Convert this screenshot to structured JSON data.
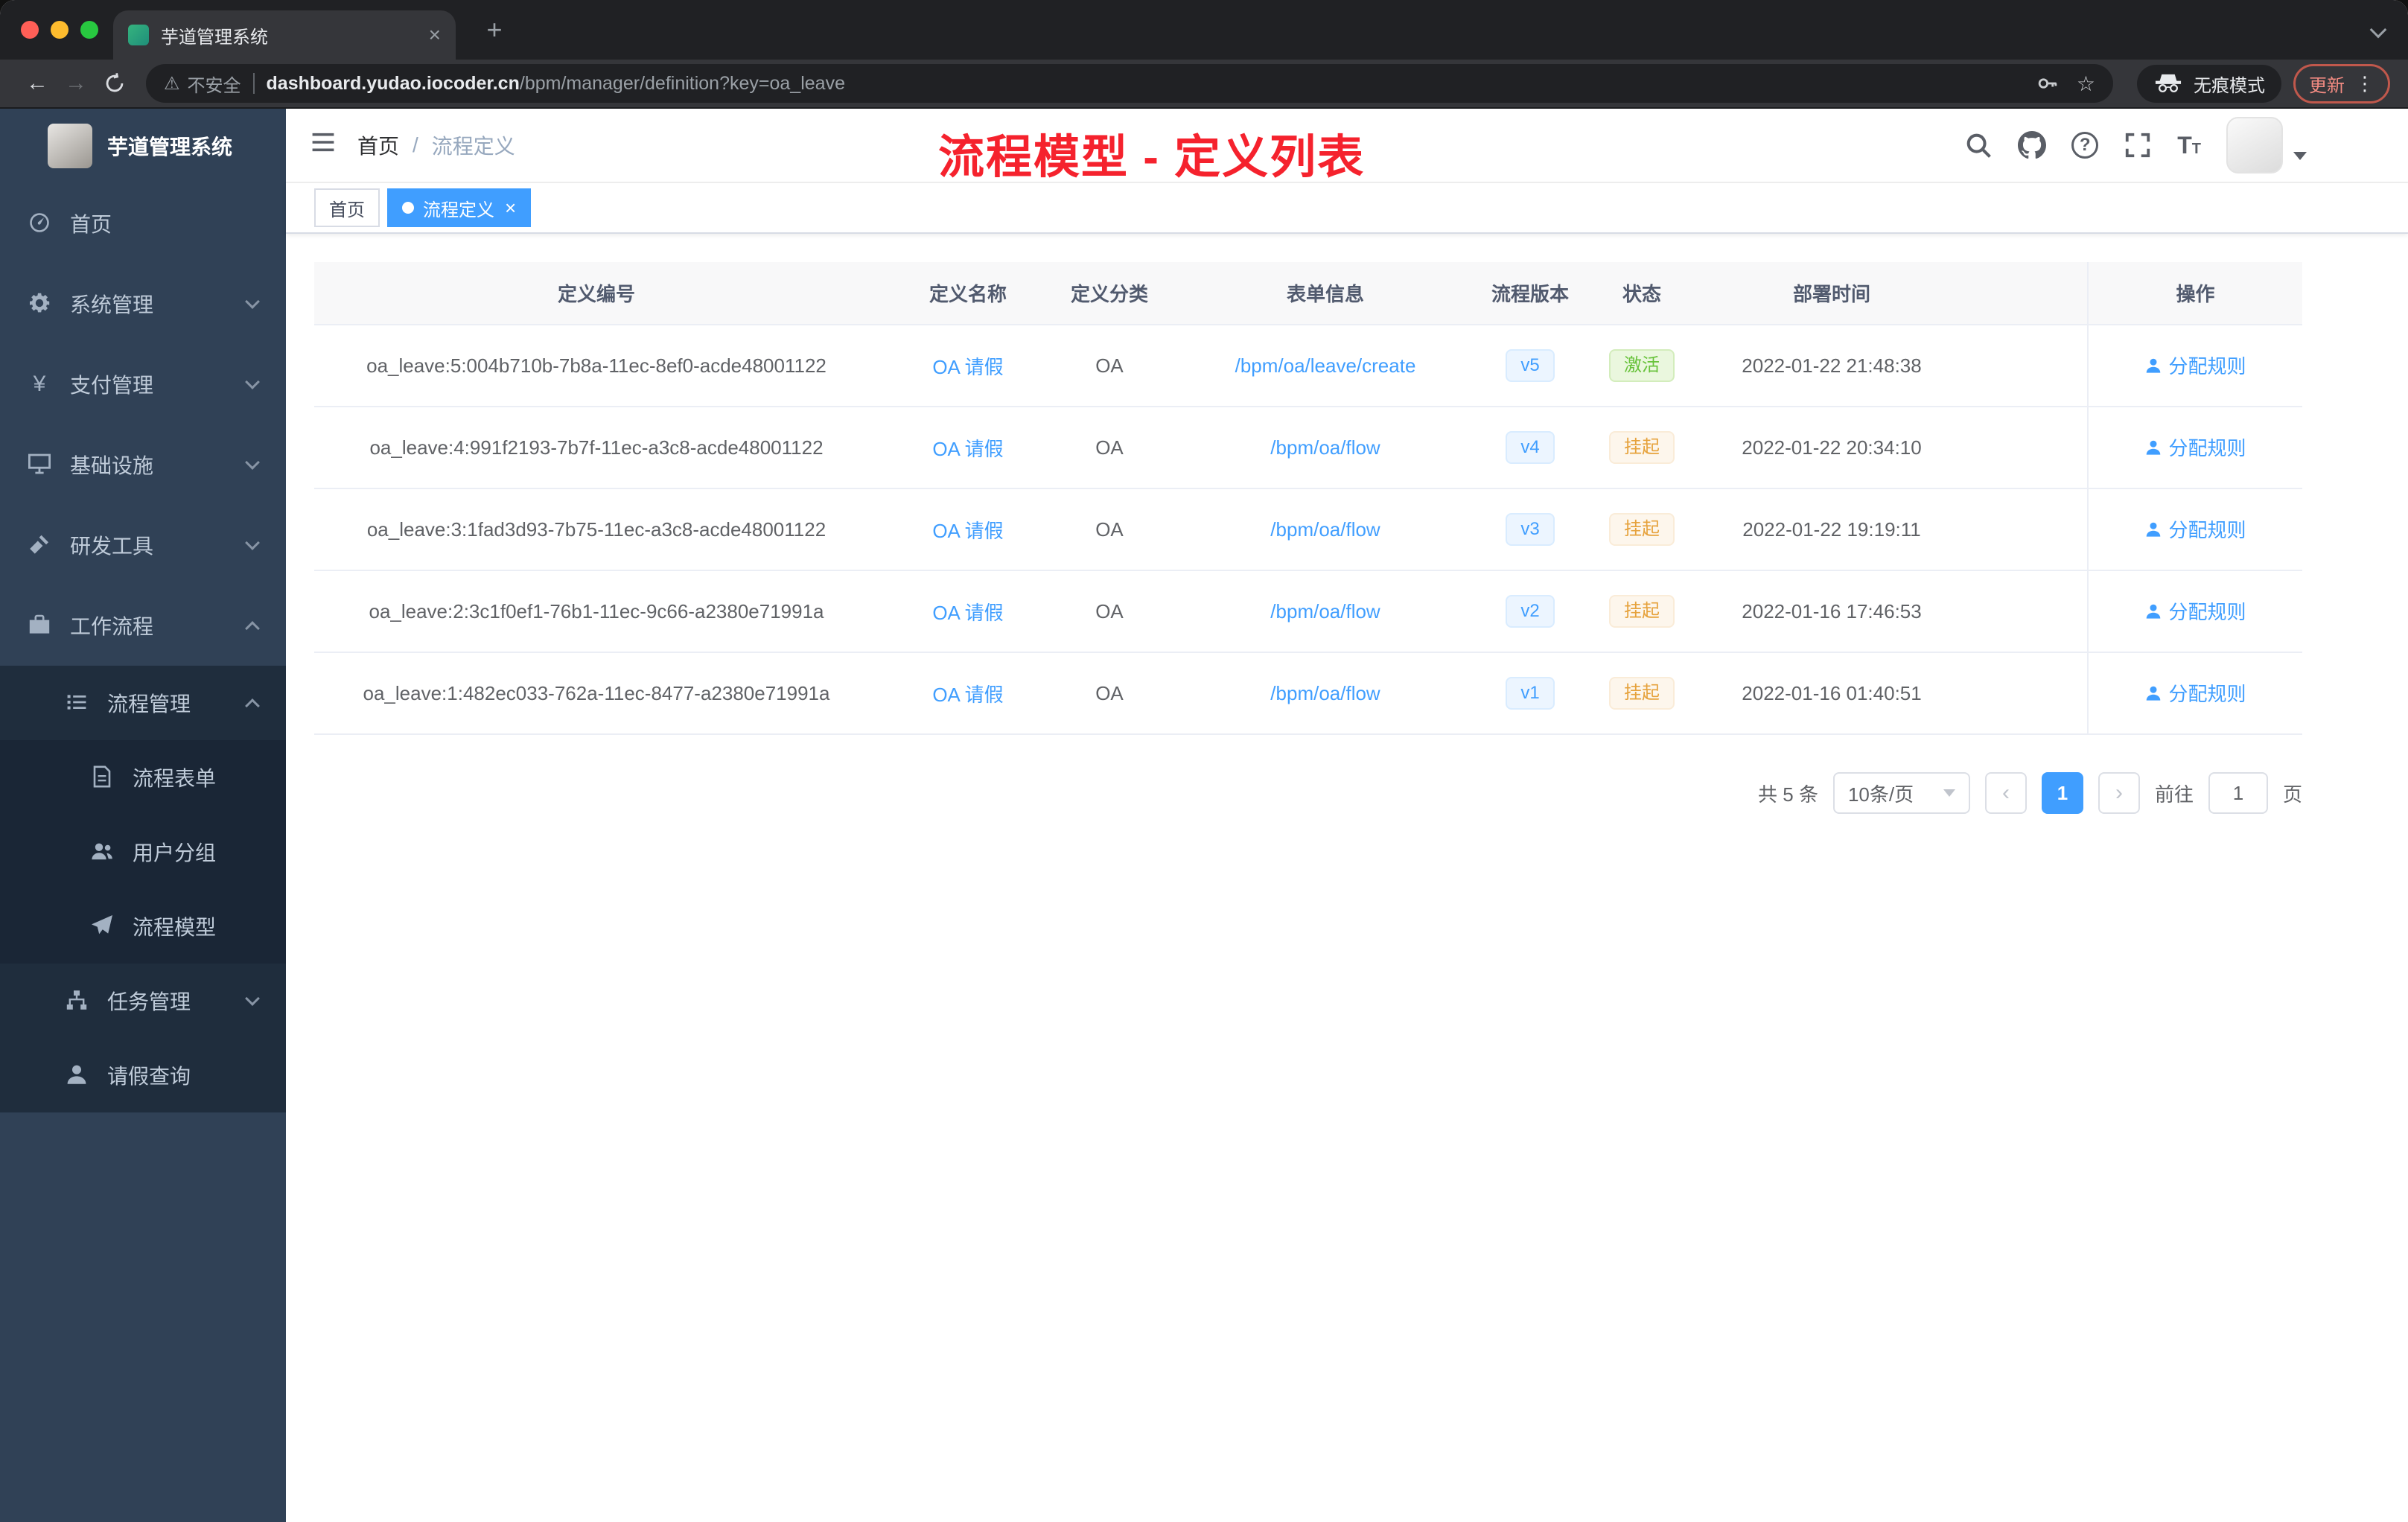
{
  "colors": {
    "accent": "#409eff",
    "success": "#67c23a",
    "warning": "#e6a23c",
    "annotation_red": "#f5222d",
    "sidebar_bg": "#304156",
    "submenu_bg": "#1f2d3d"
  },
  "browser": {
    "tab_title": "芋道管理系统",
    "security_label": "不安全",
    "url_domain": "dashboard.yudao.iocoder.cn",
    "url_path": "/bpm/manager/definition?key=oa_leave",
    "incognito_label": "无痕模式",
    "update_label": "更新"
  },
  "sidebar": {
    "logo_title": "芋道管理系统",
    "items": [
      {
        "label": "首页"
      },
      {
        "label": "系统管理"
      },
      {
        "label": "支付管理"
      },
      {
        "label": "基础设施"
      },
      {
        "label": "研发工具"
      },
      {
        "label": "工作流程"
      },
      {
        "label": "流程管理"
      },
      {
        "label": "流程表单"
      },
      {
        "label": "用户分组"
      },
      {
        "label": "流程模型"
      },
      {
        "label": "任务管理"
      },
      {
        "label": "请假查询"
      }
    ]
  },
  "navbar": {
    "breadcrumb_home": "首页",
    "breadcrumb_sep": "/",
    "breadcrumb_current": "流程定义"
  },
  "annotation": "流程模型 - 定义列表",
  "tags": {
    "home": "首页",
    "current": "流程定义",
    "close": "×"
  },
  "table": {
    "headers": [
      "定义编号",
      "定义名称",
      "定义分类",
      "表单信息",
      "流程版本",
      "状态",
      "部署时间",
      "操作"
    ],
    "rows": [
      {
        "id": "oa_leave:5:004b710b-7b8a-11ec-8ef0-acde48001122",
        "name": "OA 请假",
        "category": "OA",
        "form": "/bpm/oa/leave/create",
        "version": "v5",
        "status": "激活",
        "time": "2022-01-22 21:48:38",
        "action": "分配规则"
      },
      {
        "id": "oa_leave:4:991f2193-7b7f-11ec-a3c8-acde48001122",
        "name": "OA 请假",
        "category": "OA",
        "form": "/bpm/oa/flow",
        "version": "v4",
        "status": "挂起",
        "time": "2022-01-22 20:34:10",
        "action": "分配规则"
      },
      {
        "id": "oa_leave:3:1fad3d93-7b75-11ec-a3c8-acde48001122",
        "name": "OA 请假",
        "category": "OA",
        "form": "/bpm/oa/flow",
        "version": "v3",
        "status": "挂起",
        "time": "2022-01-22 19:19:11",
        "action": "分配规则"
      },
      {
        "id": "oa_leave:2:3c1f0ef1-76b1-11ec-9c66-a2380e71991a",
        "name": "OA 请假",
        "category": "OA",
        "form": "/bpm/oa/flow",
        "version": "v2",
        "status": "挂起",
        "time": "2022-01-16 17:46:53",
        "action": "分配规则"
      },
      {
        "id": "oa_leave:1:482ec033-762a-11ec-8477-a2380e71991a",
        "name": "OA 请假",
        "category": "OA",
        "form": "/bpm/oa/flow",
        "version": "v1",
        "status": "挂起",
        "time": "2022-01-16 01:40:51",
        "action": "分配规则"
      }
    ]
  },
  "pagination": {
    "total": "共 5 条",
    "page_size": "10条/页",
    "prev": "‹",
    "page": "1",
    "next": "›",
    "goto": "前往",
    "goto_value": "1",
    "unit": "页"
  }
}
